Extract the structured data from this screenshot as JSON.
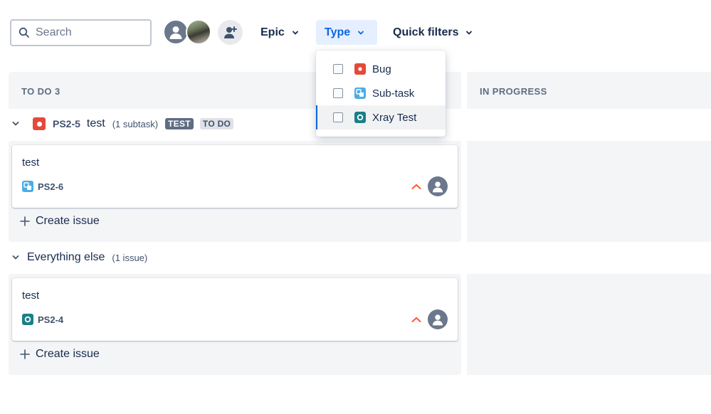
{
  "search": {
    "placeholder": "Search"
  },
  "filters": {
    "epic_label": "Epic",
    "type_label": "Type",
    "quick_label": "Quick filters"
  },
  "type_menu": {
    "items": [
      {
        "label": "Bug",
        "icon": "bug-icon",
        "checked": false
      },
      {
        "label": "Sub-task",
        "icon": "subtask-icon",
        "checked": false
      },
      {
        "label": "Xray Test",
        "icon": "xray-test-icon",
        "checked": false
      }
    ]
  },
  "columns": {
    "todo": {
      "header": "TO DO 3"
    },
    "in_progress": {
      "header": "IN PROGRESS"
    }
  },
  "groups": [
    {
      "key": "PS2-5",
      "title": "test",
      "count": "(1 subtask)",
      "lozenge_type": "TEST",
      "lozenge_status": "TO DO",
      "card": {
        "title": "test",
        "key": "PS2-6",
        "icon": "subtask-icon"
      },
      "create_label": "Create issue"
    },
    {
      "title": "Everything else",
      "count": "(1 issue)",
      "card": {
        "title": "test",
        "key": "PS2-4",
        "icon": "xray-test-icon"
      },
      "create_label": "Create issue"
    }
  ],
  "colors": {
    "bug": "#e5493a",
    "subtask": "#4bade8",
    "xray": "#1b7f86",
    "priority": "#ff5630",
    "accent": "#0c66e4"
  }
}
